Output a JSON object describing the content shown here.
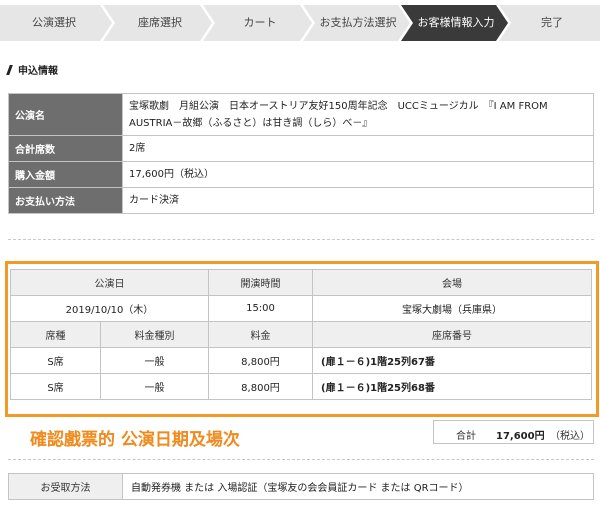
{
  "steps": [
    {
      "label": "公演選択",
      "active": false
    },
    {
      "label": "座席選択",
      "active": false
    },
    {
      "label": "カート",
      "active": false
    },
    {
      "label": "お支払方法選択",
      "active": false
    },
    {
      "label": "お客様情報入力",
      "active": true
    },
    {
      "label": "完了",
      "active": false
    }
  ],
  "section": {
    "title": "申込情報"
  },
  "info": {
    "performance_label": "公演名",
    "performance_value": "宝塚歌劇　月組公演　日本オーストリア友好150周年記念　UCCミュージカル　『I AM FROM AUSTRIA－故郷（ふるさと）は甘き調（しら）べ－』",
    "seats_label": "合計席数",
    "seats_value": "2席",
    "amount_label": "購入金額",
    "amount_value": "17,600円（税込）",
    "payment_label": "お支払い方法",
    "payment_value": "カード決済"
  },
  "tickets": {
    "headers_top": {
      "date": "公演日",
      "time": "開演時間",
      "venue": "会場"
    },
    "date": "2019/10/10（木）",
    "time": "15:00",
    "venue": "宝塚大劇場（兵庫県）",
    "headers_bottom": {
      "seat_type": "席種",
      "price_type": "料金種別",
      "price": "料金",
      "seat_no": "座席番号"
    },
    "rows": [
      {
        "seat_type": "S席",
        "price_type": "一般",
        "price": "8,800円",
        "seat_no": "(扉１－６)1階25列67番"
      },
      {
        "seat_type": "S席",
        "price_type": "一般",
        "price": "8,800円",
        "seat_no": "(扉１－６)1階25列68番"
      }
    ]
  },
  "annotation": "確認戲票的 公演日期及場次",
  "total": {
    "label": "合計",
    "amount": "17,600円",
    "tax": "（税込）"
  },
  "receive": {
    "label": "お受取方法",
    "value": "自動発券機 または 入場認証（宝塚友の会会員証カード または QRコード）"
  },
  "colors": {
    "active_step": "#3a3a3a",
    "step_bg": "#e6e6e6",
    "highlight": "#f29a27",
    "annotation": "#f08a1c",
    "header_dark": "#6e6e6e"
  }
}
